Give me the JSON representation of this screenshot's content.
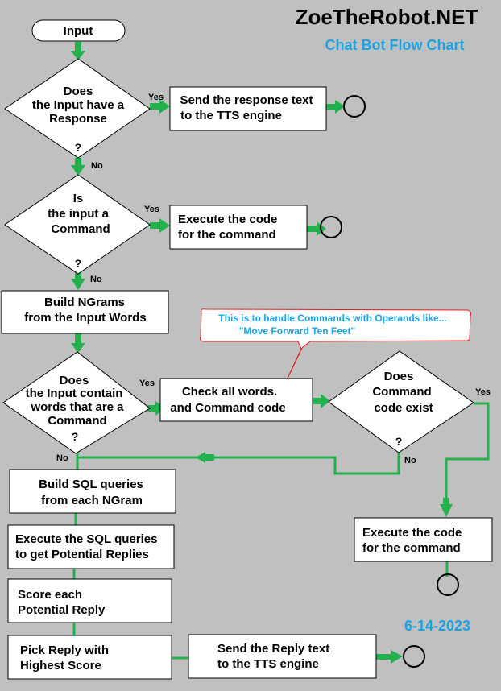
{
  "header": {
    "title": "ZoeTheRobot.NET",
    "subtitle": "Chat Bot Flow Chart",
    "date": "6-14-2023"
  },
  "colors": {
    "background": "#c0c0c0",
    "connector": "#22b14c",
    "accent_text": "#1aa3e0",
    "callout_border": "#e02020"
  },
  "nodes": {
    "input": "Input",
    "decision_response": [
      "Does",
      "the Input have a",
      "Response",
      "?"
    ],
    "send_response": [
      "Send the response text",
      "to the TTS engine"
    ],
    "decision_command": [
      "Is",
      "the input a",
      "Command",
      "?"
    ],
    "exec_command_1": [
      "Execute the code",
      "for the command"
    ],
    "build_ngrams": [
      "Build NGrams",
      "from the Input Words"
    ],
    "decision_contains": [
      "Does",
      "the Input contain",
      "words that are a",
      "Command",
      "?"
    ],
    "check_words": [
      "Check all words.",
      "and Command code"
    ],
    "decision_code_exists": [
      "Does",
      "Command",
      "code exist",
      "?"
    ],
    "exec_command_2": [
      "Execute the code",
      "for the command"
    ],
    "build_sql": [
      "Build SQL queries",
      "from each NGram"
    ],
    "exec_sql": [
      "Execute the SQL queries",
      "to get Potential Replies"
    ],
    "score": [
      "Score each",
      "Potential Reply"
    ],
    "pick": [
      "Pick Reply with",
      "Highest Score"
    ],
    "send_reply": [
      "Send the Reply text",
      "to the TTS engine"
    ]
  },
  "labels": {
    "yes": "Yes",
    "no": "No"
  },
  "callout": [
    "This is to handle Commands with Operands like...",
    "\"Move Forward Ten Feet\""
  ]
}
